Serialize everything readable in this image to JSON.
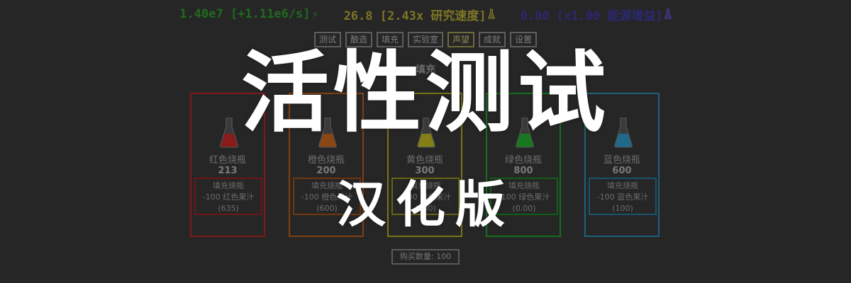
{
  "stats": {
    "energy": "1.40e7 [+1.11e6/s]",
    "energy_icon": "lightning-icon",
    "research": "26.8 [2.43x 研究速度]",
    "research_icon": "flask-icon",
    "power": "0.00 [x1.00 能源增益]",
    "power_icon": "flask-icon",
    "colors": {
      "energy": "#1f6b1f",
      "research": "#7d7524",
      "power": "#2b2872"
    }
  },
  "tabs": [
    {
      "label": "测试"
    },
    {
      "label": "酿造"
    },
    {
      "label": "填充"
    },
    {
      "label": "实验室"
    },
    {
      "label": "声望",
      "active": true
    },
    {
      "label": "成就"
    },
    {
      "label": "设置"
    }
  ],
  "section": {
    "heading": "填充"
  },
  "flasks": [
    {
      "name": "红色烧瓶",
      "count": "213",
      "fill_label": "填充烧瓶",
      "cost": "-100 红色果汁",
      "available": "(635)",
      "color": "#b02323"
    },
    {
      "name": "橙色烧瓶",
      "count": "200",
      "fill_label": "填充烧瓶",
      "cost": "-100 橙色果汁",
      "available": "(600)",
      "color": "#b35a1a"
    },
    {
      "name": "黄色烧瓶",
      "count": "300",
      "fill_label": "填充烧瓶",
      "cost": "-100 黄色果汁",
      "available": "(900)",
      "color": "#a8a21e"
    },
    {
      "name": "绿色烧瓶",
      "count": "800",
      "fill_label": "填充烧瓶",
      "cost": "-100 绿色果汁",
      "available": "(0.00)",
      "color": "#1f9a28"
    },
    {
      "name": "蓝色烧瓶",
      "count": "600",
      "fill_label": "填充烧瓶",
      "cost": "-100 蓝色果汁",
      "available": "(100)",
      "color": "#2a86b0"
    }
  ],
  "buy_amount": "购买数量: 100",
  "banner": {
    "title": "活性测试",
    "subtitle": "汉化版"
  }
}
